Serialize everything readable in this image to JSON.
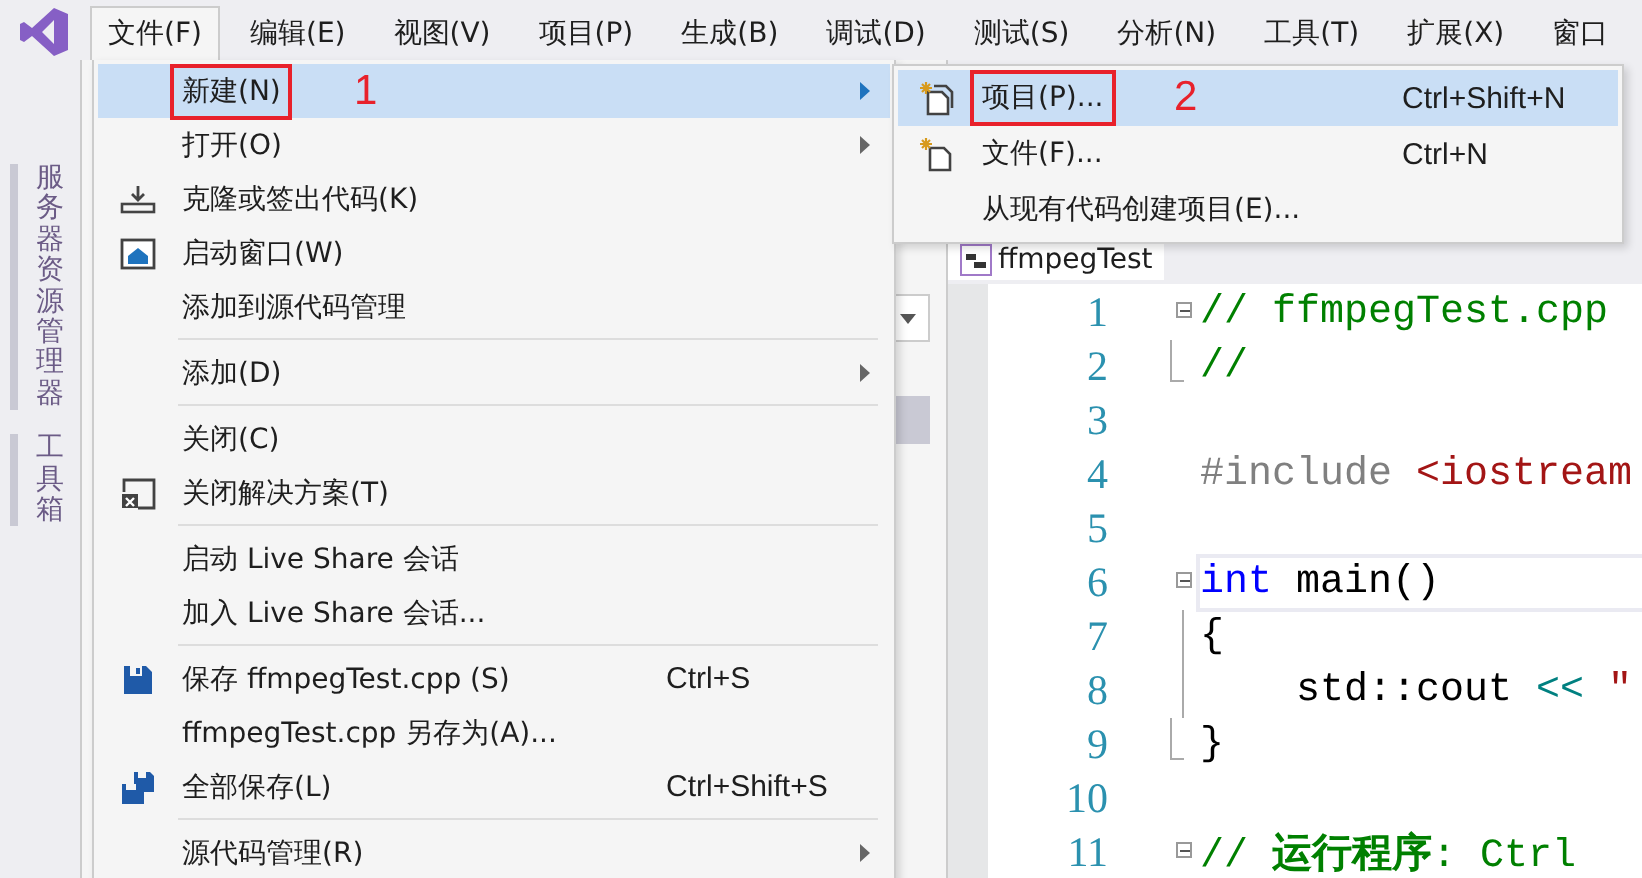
{
  "menubar": [
    {
      "label": "文件(F)",
      "selected": true
    },
    {
      "label": "编辑(E)",
      "selected": false
    },
    {
      "label": "视图(V)",
      "selected": false
    },
    {
      "label": "项目(P)",
      "selected": false
    },
    {
      "label": "生成(B)",
      "selected": false
    },
    {
      "label": "调试(D)",
      "selected": false
    },
    {
      "label": "测试(S)",
      "selected": false
    },
    {
      "label": "分析(N)",
      "selected": false
    },
    {
      "label": "工具(T)",
      "selected": false
    },
    {
      "label": "扩展(X)",
      "selected": false
    },
    {
      "label": "窗口",
      "selected": false
    }
  ],
  "side_tabs": [
    {
      "label": "服务器资源管理器"
    },
    {
      "label": "工具箱"
    }
  ],
  "editor": {
    "file_tab": "ffmpegTest",
    "lines": [
      {
        "number": "1",
        "current": false,
        "tokens": [
          {
            "t": "// ffmpegTest.cpp",
            "kind": "comment"
          }
        ]
      },
      {
        "number": "2",
        "current": false,
        "tokens": [
          {
            "t": "//",
            "kind": "comment"
          }
        ]
      },
      {
        "number": "3",
        "current": false
      },
      {
        "number": "4",
        "current": false,
        "tokens": [
          {
            "t": "#include",
            "kind": "preproc"
          },
          {
            "t": " <iostream",
            "kind": "string"
          }
        ]
      },
      {
        "number": "5",
        "current": false
      },
      {
        "number": "6",
        "current": true,
        "tokens": [
          {
            "t": "int",
            "kind": "keyword"
          },
          {
            "t": " main()",
            "kind": "plain"
          }
        ]
      },
      {
        "number": "7",
        "current": false,
        "tokens": [
          {
            "t": "{",
            "kind": "plain"
          }
        ]
      },
      {
        "number": "8",
        "current": false,
        "tokens": [
          {
            "t": "    std::cout ",
            "kind": "plain"
          },
          {
            "t": "<<",
            "kind": "operator"
          },
          {
            "t": " \"",
            "kind": "string"
          }
        ]
      },
      {
        "number": "9",
        "current": false,
        "tokens": [
          {
            "t": "}",
            "kind": "plain"
          }
        ]
      },
      {
        "number": "10",
        "current": false
      },
      {
        "number": "11",
        "current": false,
        "tokens": [
          {
            "t": "// ",
            "kind": "comment"
          },
          {
            "t": "运行程序",
            "kind": "comment-bold"
          },
          {
            "t": ": Ctrl",
            "kind": "comment"
          }
        ]
      }
    ]
  },
  "file_menu": [
    {
      "kind": "item",
      "label": "新建(N)",
      "submenu": true,
      "selected": true,
      "boxed": true,
      "annotation": "1"
    },
    {
      "kind": "item",
      "label": "打开(O)",
      "submenu": true,
      "selected": false,
      "boxed": false
    },
    {
      "kind": "item",
      "label": "克隆或签出代码(K)",
      "submenu": false,
      "selected": false,
      "boxed": false
    },
    {
      "kind": "item",
      "label": "启动窗口(W)",
      "submenu": false,
      "selected": false,
      "boxed": false
    },
    {
      "kind": "item",
      "label": "添加到源代码管理",
      "submenu": false,
      "selected": false,
      "boxed": false
    },
    {
      "kind": "separator"
    },
    {
      "kind": "item",
      "label": "添加(D)",
      "submenu": true,
      "selected": false,
      "boxed": false
    },
    {
      "kind": "separator"
    },
    {
      "kind": "item",
      "label": "关闭(C)",
      "submenu": false,
      "selected": false,
      "boxed": false
    },
    {
      "kind": "item",
      "label": "关闭解决方案(T)",
      "submenu": false,
      "selected": false,
      "boxed": false
    },
    {
      "kind": "separator"
    },
    {
      "kind": "item",
      "label": "启动 Live Share 会话",
      "submenu": false,
      "selected": false,
      "boxed": false
    },
    {
      "kind": "item",
      "label": "加入 Live Share 会话...",
      "submenu": false,
      "selected": false,
      "boxed": false
    },
    {
      "kind": "separator"
    },
    {
      "kind": "item",
      "label": "保存 ffmpegTest.cpp (S)",
      "shortcut": "Ctrl+S",
      "submenu": false,
      "selected": false,
      "boxed": false
    },
    {
      "kind": "item",
      "label": "ffmpegTest.cpp 另存为(A)...",
      "submenu": false,
      "selected": false,
      "boxed": false
    },
    {
      "kind": "item",
      "label": "全部保存(L)",
      "shortcut": "Ctrl+Shift+S",
      "submenu": false,
      "selected": false,
      "boxed": false
    },
    {
      "kind": "separator"
    },
    {
      "kind": "item",
      "label": "源代码管理(R)",
      "submenu": true,
      "selected": false,
      "boxed": false
    }
  ],
  "new_submenu": [
    {
      "kind": "item",
      "label": "项目(P)...",
      "shortcut": "Ctrl+Shift+N",
      "selected": true,
      "boxed": true,
      "annotation": "2"
    },
    {
      "kind": "item",
      "label": "文件(F)...",
      "shortcut": "Ctrl+N",
      "selected": false,
      "boxed": false
    },
    {
      "kind": "item",
      "label": "从现有代码创建项目(E)...",
      "selected": false,
      "boxed": false
    }
  ]
}
